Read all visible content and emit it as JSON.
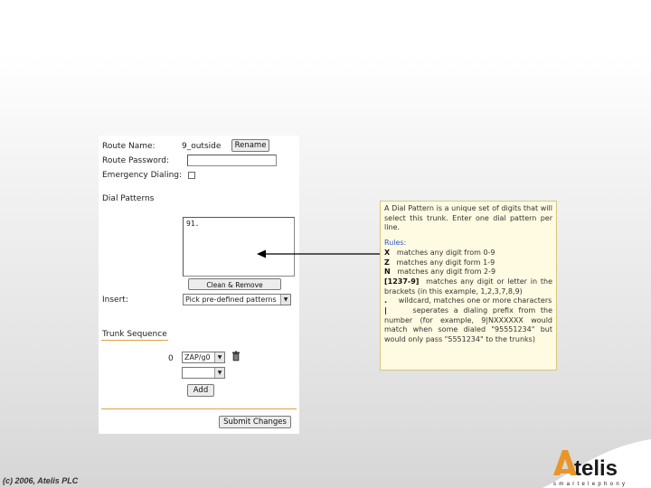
{
  "form": {
    "route_name_label": "Route Name:",
    "route_name_value": "9_outside",
    "rename_button": "Rename",
    "route_password_label": "Route Password:",
    "emergency_dialing_label": "Emergency Dialing:",
    "dial_patterns_heading": "Dial Patterns",
    "dial_patterns_value": "91.",
    "clean_button": "Clean & Remove duplicates",
    "insert_label": "Insert:",
    "insert_select_value": "Pick pre-defined patterns",
    "trunk_sequence_heading": "Trunk Sequence",
    "trunk_index": "0",
    "trunk_select_value": "ZAP/g0",
    "trunk_select_empty": "",
    "add_button": "Add",
    "submit_button": "Submit Changes"
  },
  "callout": {
    "intro": "A Dial Pattern is a unique set of digits that will select this trunk. Enter one dial pattern per line.",
    "rules_title": "Rules:",
    "rules": [
      {
        "key": "X",
        "text": "matches any digit from 0-9"
      },
      {
        "key": "Z",
        "text": "matches any digit form 1-9"
      },
      {
        "key": "N",
        "text": "matches any digit from 2-9"
      },
      {
        "key": "[1237-9]",
        "text": "matches any digit or letter in the brackets (in this example, 1,2,3,7,8,9)"
      },
      {
        "key": ".",
        "text": "wildcard, matches one or more characters"
      },
      {
        "key": "|",
        "text": "seperates a dialing prefix from the number (for example, 9|NXXXXXX would match when some dialed \"95551234\" but would only pass \"5551234\" to the trunks)"
      }
    ]
  },
  "footer": {
    "copyright": "(c) 2006, Atelis PLC",
    "logo_name": "atelis",
    "logo_tagline": "smartelephony"
  },
  "colors": {
    "accent_orange": "#e8962a",
    "rules_blue": "#2c56c8",
    "callout_bg": "#fffbe2"
  }
}
